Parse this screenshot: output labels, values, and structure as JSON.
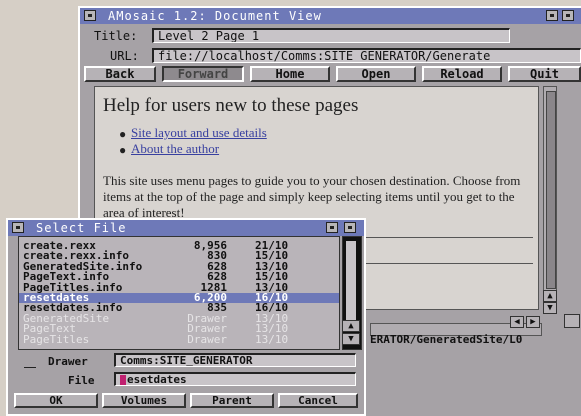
{
  "main_window": {
    "title": "AMosaic 1.2: Document View",
    "title_label": "Title:",
    "title_value": "Level 2 Page 1",
    "url_label": "URL:",
    "url_value": "file://localhost/Comms:SITE_GENERATOR/Generate",
    "buttons": [
      "Back",
      "Forward",
      "Home",
      "Open",
      "Reload",
      "Quit"
    ],
    "content": {
      "heading": "Help for users new to these pages",
      "links": [
        "Site layout and use details",
        "About the author"
      ],
      "body": "This site uses menu pages to guide you to your chosen destination. Choose from items at the top of the page and simply keep selecting items until you get to the area of interest!"
    },
    "status_url": "ERATOR/GeneratedSite/L0"
  },
  "file_requester": {
    "title": "Select File",
    "files": [
      {
        "name": "create.rexx",
        "size": "8,956",
        "date": "21/10"
      },
      {
        "name": "create.rexx.info",
        "size": "830",
        "date": "15/10"
      },
      {
        "name": "GeneratedSite.info",
        "size": "628",
        "date": "13/10"
      },
      {
        "name": "PageText.info",
        "size": "628",
        "date": "15/10"
      },
      {
        "name": "PageTitles.info",
        "size": "1281",
        "date": "13/10"
      },
      {
        "name": "resetdates",
        "size": "6,200",
        "date": "16/10"
      },
      {
        "name": "resetdates.info",
        "size": "835",
        "date": "16/10"
      },
      {
        "name": "GeneratedSite",
        "size": "Drawer",
        "date": "13/10"
      },
      {
        "name": "PageText",
        "size": "Drawer",
        "date": "13/10"
      },
      {
        "name": "PageTitles",
        "size": "Drawer",
        "date": "13/10"
      }
    ],
    "selected_index": 5,
    "drawer_label": "Drawer",
    "drawer_value": "Comms:SITE_GENERATOR",
    "file_label": "File",
    "file_value": "esetdates",
    "buttons": [
      "OK",
      "Volumes",
      "Parent",
      "Cancel"
    ]
  },
  "colors": {
    "titlebar": "#6e79b8",
    "window_bg": "#a6a2a6",
    "link": "#3840a0"
  }
}
